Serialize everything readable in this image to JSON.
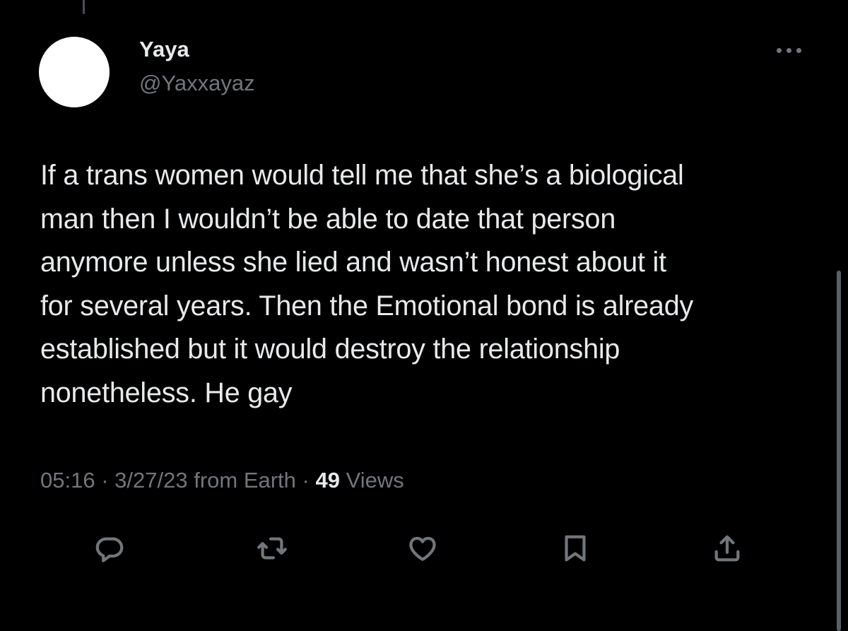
{
  "author": {
    "display_name": "Yaya",
    "handle": "@Yaxxayaz",
    "avatar_color": "#ffffff"
  },
  "tweet": {
    "text": "If a trans women would tell me that she’s a biological\nman then I wouldn’t be able to date that person\nanymore unless she lied and wasn’t honest about it\nfor several years. Then the Emotional bond is already\nestablished but it would destroy the relationship\nnonetheless. He gay",
    "time": "05:16",
    "date": "3/27/23",
    "source": "from Earth",
    "separator": " · ",
    "views_count": "49",
    "views_label": " Views"
  },
  "actions": {
    "reply_icon": "reply-icon",
    "retweet_icon": "retweet-icon",
    "like_icon": "like-icon",
    "bookmark_icon": "bookmark-icon",
    "share_icon": "share-icon"
  },
  "colors": {
    "background": "#000000",
    "primary_text": "#e7e9ea",
    "secondary_text": "#71767b"
  }
}
